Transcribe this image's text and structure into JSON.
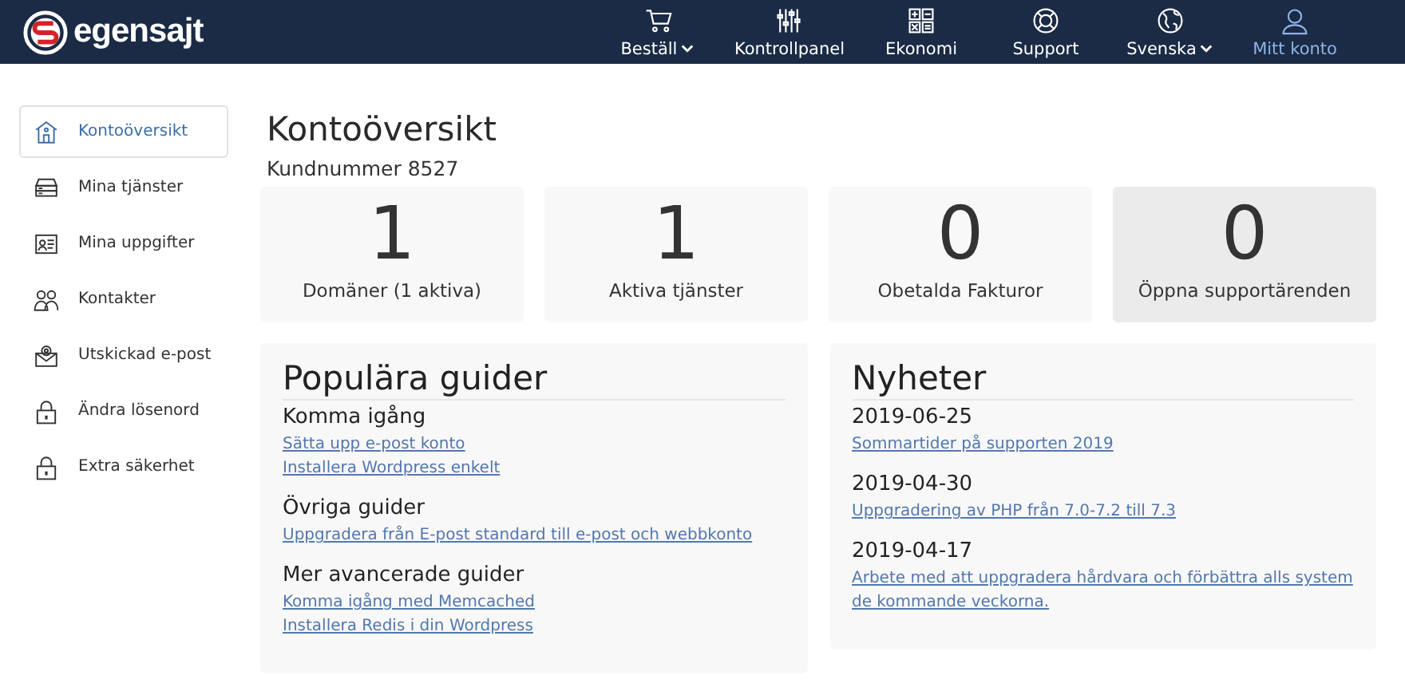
{
  "header": {
    "logo": "egensajt",
    "nav": [
      {
        "label": "Beställ",
        "dropdown": true,
        "selected": false
      },
      {
        "label": "Kontrollpanel",
        "dropdown": false,
        "selected": false
      },
      {
        "label": "Ekonomi",
        "dropdown": false,
        "selected": false
      },
      {
        "label": "Support",
        "dropdown": false,
        "selected": false
      },
      {
        "label": "Svenska",
        "dropdown": true,
        "selected": false
      },
      {
        "label": "Mitt konto",
        "dropdown": false,
        "selected": true
      }
    ]
  },
  "sidebar": {
    "items": [
      {
        "label": "Kontoöversikt",
        "selected": true
      },
      {
        "label": "Mina tjänster",
        "selected": false
      },
      {
        "label": "Mina uppgifter",
        "selected": false
      },
      {
        "label": "Kontakter",
        "selected": false
      },
      {
        "label": "Utskickad e-post",
        "selected": false
      },
      {
        "label": "Ändra lösenord",
        "selected": false
      },
      {
        "label": "Extra säkerhet",
        "selected": false
      }
    ]
  },
  "page": {
    "title": "Kontoöversikt",
    "customer_number": "Kundnummer 8527"
  },
  "stats": [
    {
      "value": "1",
      "label": "Domäner (1 aktiva)",
      "highlighted": false
    },
    {
      "value": "1",
      "label": "Aktiva tjänster",
      "highlighted": false
    },
    {
      "value": "0",
      "label": "Obetalda Fakturor",
      "highlighted": false
    },
    {
      "value": "0",
      "label": "Öppna supportärenden",
      "highlighted": true
    }
  ],
  "guides": {
    "title": "Populära guider",
    "sections": [
      {
        "heading": "Komma igång",
        "links": [
          "Sätta upp e-post konto",
          "Installera Wordpress enkelt"
        ]
      },
      {
        "heading": "Övriga guider",
        "links": [
          "Uppgradera från E-post standard till e-post och webbkonto"
        ]
      },
      {
        "heading": "Mer avancerade guider",
        "links": [
          "Komma igång med Memcached",
          "Installera Redis i din Wordpress"
        ]
      }
    ]
  },
  "news": {
    "title": "Nyheter",
    "items": [
      {
        "date": "2019-06-25",
        "link": "Sommartider på supporten 2019"
      },
      {
        "date": "2019-04-30",
        "link": "Uppgradering av PHP från 7.0-7.2 till 7.3"
      },
      {
        "date": "2019-04-17",
        "link": "Arbete med att uppgradera hårdvara och förbättra alls system de kommande veckorna."
      }
    ]
  }
}
